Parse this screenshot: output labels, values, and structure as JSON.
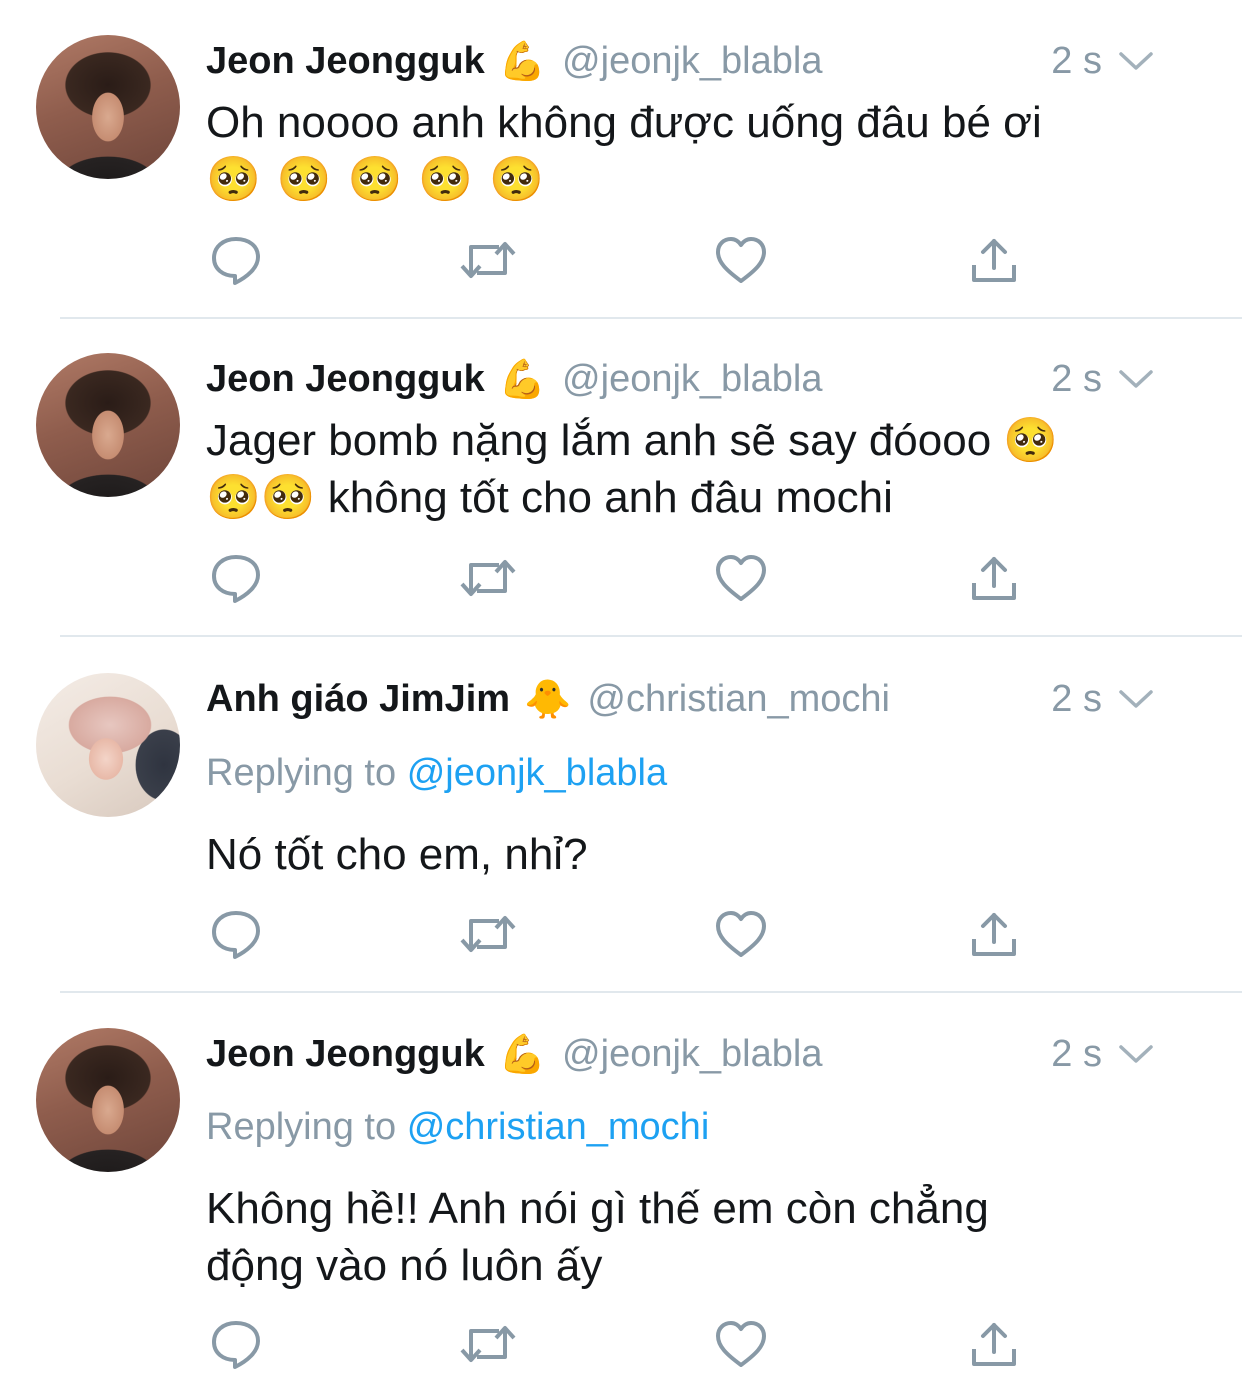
{
  "tweets": [
    {
      "name": "Jeon Jeongguk",
      "badge": "💪",
      "handle": "@jeonjk_blabla",
      "time": "2 s",
      "replying_label": "",
      "replying_to": "",
      "text_line1": "Oh noooo anh không được uống đâu bé ơi",
      "text_line2": "🥺🥺🥺🥺🥺"
    },
    {
      "name": "Jeon Jeongguk",
      "badge": "💪",
      "handle": "@jeonjk_blabla",
      "time": "2 s",
      "replying_label": "",
      "replying_to": "",
      "text_line1": "Jager bomb nặng lắm anh sẽ say đóooo 🥺",
      "text_line2": "🥺🥺 không tốt cho anh đâu mochi"
    },
    {
      "name": "Anh giáo JimJim",
      "badge": "🐥",
      "handle": "@christian_mochi",
      "time": "2 s",
      "replying_label": "Replying to",
      "replying_to": "@jeonjk_blabla",
      "text_line1": "Nó tốt cho em, nhỉ?",
      "text_line2": ""
    },
    {
      "name": "Jeon Jeongguk",
      "badge": "💪",
      "handle": "@jeonjk_blabla",
      "time": "2 s",
      "replying_label": "Replying to",
      "replying_to": "@christian_mochi",
      "text_line1": "Không hề!! Anh nói gì thế em còn chẳng",
      "text_line2": "động vào nó luôn ấy"
    }
  ],
  "icons": {
    "reply": "reply-icon",
    "retweet": "retweet-icon",
    "like": "heart-icon",
    "share": "share-icon",
    "caret": "chevron-down-icon"
  },
  "colors": {
    "text": "#14171a",
    "muted": "#8899a6",
    "link": "#1da1f2",
    "divider": "#e1e8ed"
  }
}
